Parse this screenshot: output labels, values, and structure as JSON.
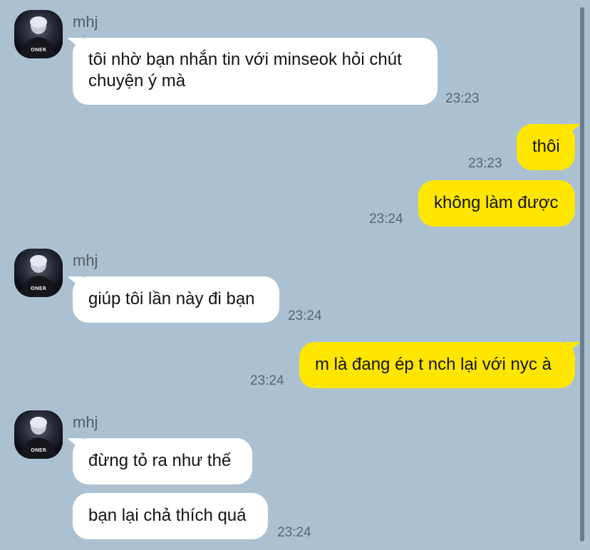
{
  "contact": {
    "name": "mhj",
    "avatar_icon": "profile-photo-icon",
    "avatar_caption": "ONER"
  },
  "messages": [
    {
      "from": "them",
      "text_lines": [
        "tôi nhờ bạn nhắn tin với minseok hỏi chút",
        "chuyện ý mà"
      ],
      "time": "23:23"
    },
    {
      "from": "me",
      "text": "thôi",
      "time": "23:23"
    },
    {
      "from": "me",
      "text": "không làm được",
      "time": "23:24"
    },
    {
      "from": "them",
      "text": "giúp tôi lần này đi bạn",
      "time": "23:24"
    },
    {
      "from": "me",
      "text": "m là đang ép t nch lại với nyc à",
      "time": "23:24"
    },
    {
      "from": "them",
      "text": "đừng tỏ ra như thế",
      "time": ""
    },
    {
      "from": "them",
      "text": "bạn lại chả thích quá",
      "time": "23:24"
    }
  ],
  "colors": {
    "background": "#abc1d1",
    "incoming_bubble": "#ffffff",
    "outgoing_bubble": "#ffe600",
    "timestamp": "#5a6670"
  }
}
